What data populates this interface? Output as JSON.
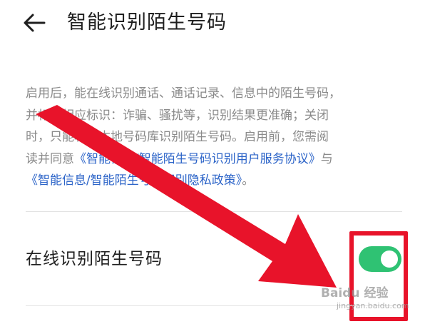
{
  "header": {
    "title": "智能识别陌生号码"
  },
  "description": {
    "line1": "启用后，能在线识别通话、通话记录、信息中的陌生号码，",
    "line2": "并标注相应标识：诈骗、骚扰等，识别结果更准确；关闭",
    "line3": "时，只能利用本地号码库识别陌生号码。启用前，您需阅",
    "line4_prefix": "读并同意",
    "link_service": "《智能信息/智能陌生号码识别用户服务协议》",
    "line4_suffix": "与",
    "link_privacy": "《智能信息/智能陌生号码识别隐私政策》",
    "line5_suffix": "。"
  },
  "setting": {
    "label": "在线识别陌生号码",
    "enabled": true
  },
  "watermark": {
    "text": "Baidu 经验",
    "sub": "jingyan.baidu.com"
  },
  "colors": {
    "toggle_on": "#2fc273",
    "link": "#2c64c8",
    "annotation_red": "#e8132a"
  }
}
